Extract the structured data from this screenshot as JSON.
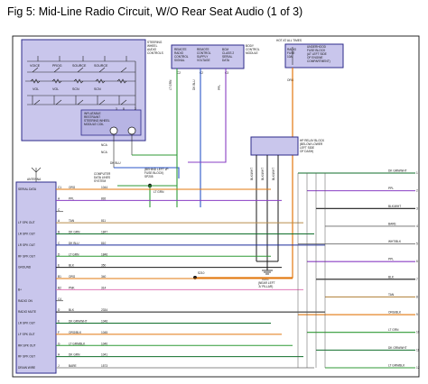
{
  "title": "Fig 5: Mid-Line Radio Circuit, W/O Rear Seat Audio (1 of 3)",
  "colors": {
    "orange": "#e2780f",
    "green": "#2f9a35",
    "dark_green": "#0f6e2a",
    "blue": "#2b56c8",
    "dark_blue": "#1a2a9a",
    "pink": "#e07ab8",
    "purple": "#8a3fc4",
    "yellow": "#d9c300",
    "gray": "#8b8b8b",
    "tan": "#b88c4a",
    "red": "#cc2222",
    "black": "#1a1a1a",
    "lavender_fill": "#c9c6ec"
  },
  "steering": {
    "label_lines": [
      "STEERING",
      "WHEEL",
      "AUDIO",
      "CONTROLS"
    ],
    "switches": [
      "VOICE",
      "PROG",
      "SOURCE",
      "SOURCE",
      "VOL",
      "VOL",
      "SCN",
      "SCN"
    ],
    "airbag_lines": [
      "INFLATABLE",
      "RESTRAINT",
      "STEERING WHEEL",
      "MODULE COIL"
    ],
    "connector_ids": [
      "3",
      "8",
      "2"
    ],
    "wire_labels": [
      "NCA",
      "NCA",
      "DK BLU"
    ]
  },
  "bcm": {
    "columns": [
      [
        "REMOTE",
        "RADIO",
        "CONTROL",
        "SIGNAL"
      ],
      [
        "REMOTE",
        "CONTROL",
        "SUPPLY",
        "VOLTAGE"
      ],
      [
        "BCM",
        "CLASS 2",
        "SERIAL",
        "DATA"
      ]
    ],
    "name_lines": [
      "BODY",
      "CONTROL",
      "MODULE"
    ],
    "pins": [
      "C2",
      "C2",
      "C3"
    ],
    "wires": [
      "LT GRN",
      "DK BLU",
      "PPL"
    ]
  },
  "fuse_top": {
    "lines": [
      "HOT AT ALL TIMES",
      "UNDERHOOD",
      "FUSE BLOCK",
      "(AT LEFT SIDE",
      "OF ENGINE",
      "COMPARTMENT)"
    ],
    "fuse_lines": [
      "RADIO",
      "FUSE",
      "10A"
    ],
    "wire": "ORG"
  },
  "relay_block": {
    "lines": [
      "HP RELAY BLOCK",
      "(BELOW LOWER",
      "LEFT SIDE",
      "OF DASH)"
    ],
    "wires": [
      "BLK/WHT",
      "BLK/WHT",
      "BLK/WHT"
    ]
  },
  "data_link": {
    "lines": [
      "COMPUTER",
      "DATA LINES",
      "SYSTEM"
    ],
    "splice_lines": [
      "(BEHIND LEFT I/P",
      "FUSE BLOCK)",
      "SP205"
    ],
    "wire": "LT GRN"
  },
  "ground": {
    "id": "G201",
    "lines": [
      "(NEAR LEFT",
      "'A' PILLAR)"
    ]
  },
  "splice_s210": "S210",
  "antenna": "ANTENNA",
  "radio": {
    "rows": [
      {
        "label": "SERIAL DATA",
        "pin": "C1",
        "wire": "ORG",
        "code": "1044"
      },
      {
        "label": "",
        "pin": "A",
        "wire": "PPL",
        "code": "892"
      },
      {
        "label": "",
        "pin": "C",
        "wire": "",
        "code": ""
      },
      {
        "label": "LF SPK OUT",
        "pin": "A",
        "wire": "TAN",
        "code": "811"
      },
      {
        "label": "LR SPK OUT",
        "pin": "B",
        "wire": "DK GRN",
        "code": "1847"
      },
      {
        "label": "LR SPK OUT",
        "pin": "C",
        "wire": "DK BLU",
        "code": "810"
      },
      {
        "label": "RF SPK OUT",
        "pin": "D",
        "wire": "LT GRN",
        "code": "1846"
      },
      {
        "label": "GROUND",
        "pin": "E",
        "wire": "BLK",
        "code": "350"
      },
      {
        "label": "",
        "pin": "B1",
        "wire": "ORG",
        "code": "340"
      },
      {
        "label": "B+",
        "pin": "B2",
        "wire": "PNK",
        "code": "314"
      },
      {
        "label": "RADIO ON",
        "pin": "C4",
        "wire": "",
        "code": ""
      },
      {
        "label": "RADIO MUTE",
        "pin": "D",
        "wire": "BLK",
        "code": "2334"
      },
      {
        "label": "LR SPK OUT",
        "pin": "E",
        "wire": "DK GRN/WHT",
        "code": "1046"
      },
      {
        "label": "LF SPK OUT",
        "pin": "F",
        "wire": "ORG/BLK",
        "code": "1045"
      },
      {
        "label": "RR SPK OUT",
        "pin": "G",
        "wire": "LT GRN/BLK",
        "code": "1040"
      },
      {
        "label": "RF SPK OUT",
        "pin": "H",
        "wire": "DK GRN",
        "code": "1041"
      },
      {
        "label": "DRAIN WIRE",
        "pin": "J",
        "wire": "BARE",
        "code": "1573"
      }
    ]
  },
  "right_wires": [
    {
      "name": "DK GRN/WHT",
      "pin": "1"
    },
    {
      "name": "PPL",
      "pin": "2"
    },
    {
      "name": "BLK/WHT",
      "pin": "3"
    },
    {
      "name": "BARE",
      "pin": "4"
    },
    {
      "name": "WHT/BLK",
      "pin": "5"
    },
    {
      "name": "PPL",
      "pin": "6"
    },
    {
      "name": "BLK",
      "pin": "7"
    },
    {
      "name": "TAN",
      "pin": "8"
    },
    {
      "name": "ORG/BLK",
      "pin": "9"
    },
    {
      "name": "LT GRN",
      "pin": "10"
    },
    {
      "name": "DK GRN/WHT",
      "pin": "11"
    },
    {
      "name": "LT GRN/BLK",
      "pin": "12"
    }
  ]
}
